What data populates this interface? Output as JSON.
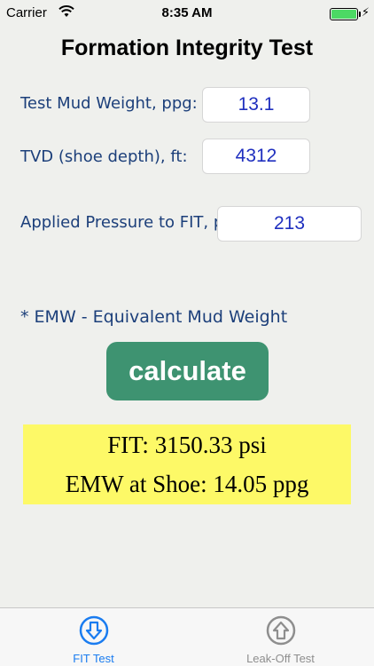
{
  "status_bar": {
    "carrier": "Carrier",
    "time": "8:35 AM"
  },
  "title": "Formation Integrity Test",
  "inputs": {
    "mud_weight": {
      "label": "Test Mud Weight, ppg:",
      "value": "13.1"
    },
    "tvd": {
      "label": "TVD (shoe depth), ft:",
      "value": "4312"
    },
    "applied_pressure": {
      "label": "Applied Pressure to FIT, psi:",
      "value": "213"
    }
  },
  "note": "* EMW - Equivalent Mud Weight",
  "calculate_label": "calculate",
  "results": {
    "fit": "FIT: 3150.33 psi",
    "emw": "EMW at Shoe: 14.05 ppg"
  },
  "tabs": [
    {
      "label": "FIT Test",
      "icon": "down-arrow-circle-icon",
      "active": true,
      "color": "#1a7cf0"
    },
    {
      "label": "Leak-Off Test",
      "icon": "up-arrow-circle-icon",
      "active": false,
      "color": "#8e8e8e"
    }
  ],
  "colors": {
    "accent_green": "#3e9371",
    "result_yellow": "#fdf967",
    "label_blue": "#1c3f7a",
    "value_blue": "#1f2fbf"
  }
}
